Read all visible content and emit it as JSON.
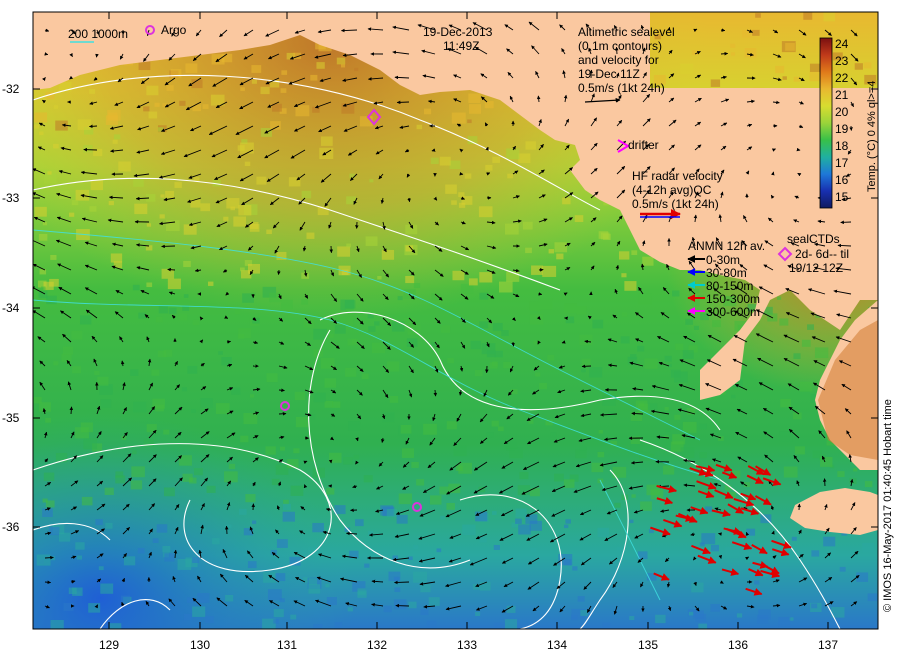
{
  "header": {
    "date": "19-Dec-2013",
    "time": "11:49Z"
  },
  "bathymetry_legend": {
    "label": "200  1000m"
  },
  "argo_legend": {
    "label": "Argo"
  },
  "altimetry_legend": {
    "lines": [
      "Altimetric sealevel",
      "(0.1m contours)",
      "and velocity for",
      "19-Dec 11Z",
      "0.5m/s (1kt 24h)"
    ]
  },
  "drifter_legend": {
    "label": "drifter"
  },
  "hf_radar_legend": {
    "lines": [
      "HF radar velocity",
      "(4-12h avg)QC",
      "0.5m/s (1kt 24h)"
    ]
  },
  "anmn_legend": {
    "title": "ANMN 12h av.",
    "items": [
      {
        "label": "0-30m",
        "color": "#000000"
      },
      {
        "label": "30-80m",
        "color": "#0000ff"
      },
      {
        "label": "80-150m",
        "color": "#00cccc"
      },
      {
        "label": "150-300m",
        "color": "#ff0000"
      },
      {
        "label": "300-600m",
        "color": "#ff00ff"
      }
    ]
  },
  "sealctd_legend": {
    "title": "sealCTDs",
    "lines": [
      "2d- 6d-- til",
      "19/12 12Z"
    ]
  },
  "colorbar": {
    "title": "Temp. (°C) 0 4% ql>=4",
    "ticks": [
      "24",
      "23",
      "22",
      "21",
      "20",
      "19",
      "18",
      "17",
      "16",
      "15"
    ],
    "colors": [
      "#8b1a1a",
      "#c03a1a",
      "#e07a1a",
      "#e8b830",
      "#d8dc30",
      "#9ad43a",
      "#38c048",
      "#20b0a0",
      "#1e78d8",
      "#1830b0",
      "#101a70"
    ]
  },
  "axes": {
    "lat_ticks": [
      "-32",
      "-33",
      "-34",
      "-35",
      "-36"
    ],
    "lon_ticks": [
      "129",
      "130",
      "131",
      "132",
      "133",
      "134",
      "135",
      "136",
      "137"
    ]
  },
  "credit": "© IMOS 16-May-2017 01:40:45 Hobart time",
  "colors": {
    "land": "#fac8a0",
    "argo_marker": "#dd33dd",
    "drifter_marker": "#ff00ff",
    "hf_arrow": "#ff0000",
    "contour": "#ffffff"
  }
}
